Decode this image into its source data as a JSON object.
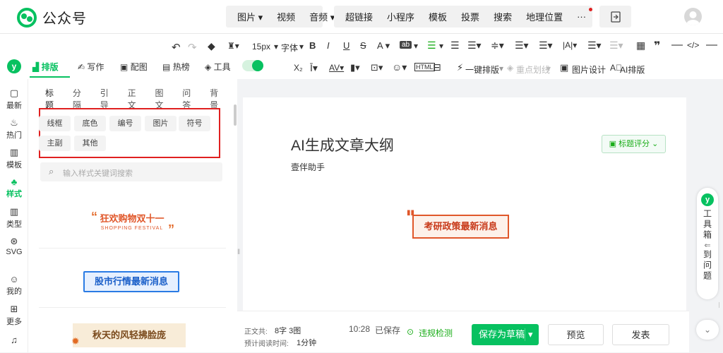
{
  "app": {
    "name": "公众号"
  },
  "top_menu_a": [
    "图片 ▾",
    "视频",
    "音频 ▾"
  ],
  "top_menu_b": [
    "超链接",
    "小程序",
    "模板",
    "投票",
    "搜索",
    "地理位置",
    "···"
  ],
  "format_toolbar": {
    "font_size": "15px",
    "font_family": "字体",
    "row2_items": [
      "一键排版",
      "重点划线",
      "图片设计",
      "AI排版"
    ]
  },
  "mode_tabs": [
    {
      "label": "排版",
      "active": true
    },
    {
      "label": "写作"
    },
    {
      "label": "配图"
    },
    {
      "label": "热榜"
    },
    {
      "label": "工具"
    }
  ],
  "left_nav": [
    "最新",
    "热门",
    "模板",
    "样式",
    "类型",
    "SVG",
    "我的",
    "更多"
  ],
  "panel": {
    "tabs": [
      "标题",
      "分隔",
      "引导",
      "正文",
      "图文",
      "问答",
      "背景"
    ],
    "chips_row1": [
      "线框",
      "底色",
      "编号",
      "图片",
      "符号"
    ],
    "chips_row2": [
      "主副",
      "其他"
    ],
    "search_placeholder": "输入样式关键词搜索",
    "banners": [
      {
        "main": "狂欢购物双十一",
        "sub": "SHOPPING FESTIVAL"
      },
      {
        "main": "股市行情最新消息"
      },
      {
        "main": "秋天的风轻拂脸庞"
      }
    ]
  },
  "editor": {
    "title": "AI生成文章大纲",
    "author": "壹伴助手",
    "title_score_btn": "标题评分",
    "banner_text": "考研政策最新消息"
  },
  "status": {
    "word_count_label": "正文共:",
    "word_count_value": "8字 3图",
    "read_time_label": "预计阅读时间:",
    "read_time_value": "1分钟",
    "saved_time": "10:28",
    "saved_label": "已保存",
    "check_label": "违规检测"
  },
  "actions": {
    "save_draft": "保存为草稿",
    "preview": "预览",
    "publish": "发表"
  },
  "toolbox": {
    "label": "工具箱",
    "goto": "到问题"
  },
  "colors": {
    "brand_green": "#07c160",
    "toolbar_green": "#1aad19",
    "chip_red": "#e02020"
  }
}
